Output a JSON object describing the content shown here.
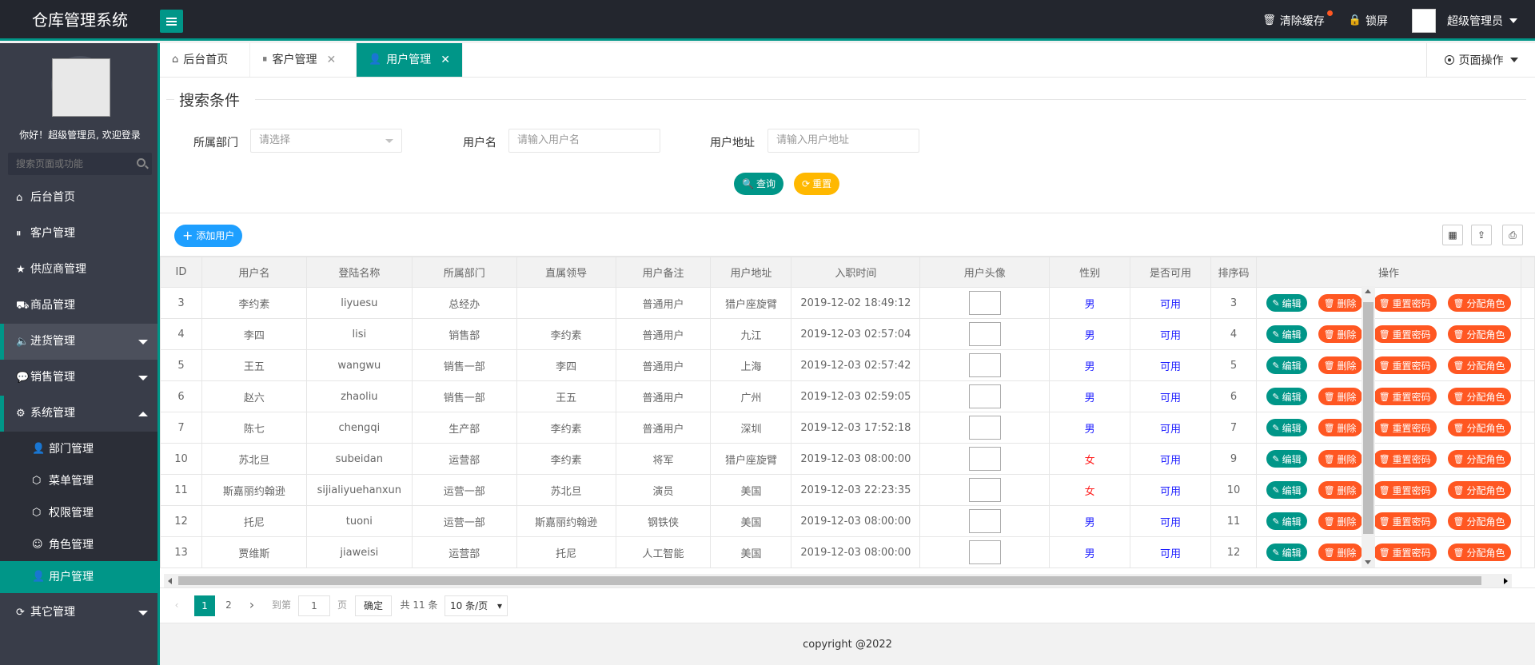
{
  "app": {
    "title": "仓库管理系统"
  },
  "header": {
    "clear_cache": "清除缓存",
    "lock_screen": "锁屏",
    "user": "超级管理员"
  },
  "sidebar": {
    "welcome": "你好！超级管理员, 欢迎登录",
    "search_placeholder": "搜索页面或功能",
    "items": [
      {
        "label": "后台首页",
        "icon": "home-icon"
      },
      {
        "label": "客户管理",
        "icon": "pause-circle-icon"
      },
      {
        "label": "供应商管理",
        "icon": "star-icon"
      },
      {
        "label": "商品管理",
        "icon": "cart-icon"
      },
      {
        "label": "进货管理",
        "icon": "speaker-icon"
      },
      {
        "label": "销售管理",
        "icon": "chat-icon"
      },
      {
        "label": "系统管理",
        "icon": "gear-icon"
      }
    ],
    "sub_items": [
      {
        "label": "部门管理",
        "icon": "user-outline-icon"
      },
      {
        "label": "菜单管理",
        "icon": "cube-icon"
      },
      {
        "label": "权限管理",
        "icon": "cube-icon"
      },
      {
        "label": "角色管理",
        "icon": "smile-icon"
      },
      {
        "label": "用户管理",
        "icon": "user-icon"
      }
    ],
    "other": {
      "label": "其它管理",
      "icon": "refresh-icon"
    }
  },
  "tabs": [
    {
      "label": "后台首页",
      "icon": "home-icon"
    },
    {
      "label": "客户管理",
      "icon": "pause-circle-icon"
    },
    {
      "label": "用户管理",
      "icon": "user-icon"
    }
  ],
  "page_ops": "页面操作",
  "search": {
    "legend": "搜索条件",
    "dept_label": "所属部门",
    "dept_placeholder": "请选择",
    "username_label": "用户名",
    "username_placeholder": "请输入用户名",
    "address_label": "用户地址",
    "address_placeholder": "请输入用户地址",
    "query_btn": "查询",
    "reset_btn": "重置"
  },
  "toolbar": {
    "add_user": "添加用户"
  },
  "table": {
    "headers": [
      "ID",
      "用户名",
      "登陆名称",
      "所属部门",
      "直属领导",
      "用户备注",
      "用户地址",
      "入职时间",
      "用户头像",
      "性别",
      "是否可用",
      "排序码",
      "操作"
    ],
    "rows": [
      {
        "id": "3",
        "name": "李约素",
        "login": "liyuesu",
        "dept": "总经办",
        "leader": "",
        "remark": "普通用户",
        "address": "猎户座旋臂",
        "time": "2019-12-02 18:49:12",
        "sex": "男",
        "avail": "可用",
        "order": "3"
      },
      {
        "id": "4",
        "name": "李四",
        "login": "lisi",
        "dept": "销售部",
        "leader": "李约素",
        "remark": "普通用户",
        "address": "九江",
        "time": "2019-12-03 02:57:04",
        "sex": "男",
        "avail": "可用",
        "order": "4"
      },
      {
        "id": "5",
        "name": "王五",
        "login": "wangwu",
        "dept": "销售一部",
        "leader": "李四",
        "remark": "普通用户",
        "address": "上海",
        "time": "2019-12-03 02:57:42",
        "sex": "男",
        "avail": "可用",
        "order": "5"
      },
      {
        "id": "6",
        "name": "赵六",
        "login": "zhaoliu",
        "dept": "销售一部",
        "leader": "王五",
        "remark": "普通用户",
        "address": "广州",
        "time": "2019-12-03 02:59:05",
        "sex": "男",
        "avail": "可用",
        "order": "6"
      },
      {
        "id": "7",
        "name": "陈七",
        "login": "chengqi",
        "dept": "生产部",
        "leader": "李约素",
        "remark": "普通用户",
        "address": "深圳",
        "time": "2019-12-03 17:52:18",
        "sex": "男",
        "avail": "可用",
        "order": "7"
      },
      {
        "id": "10",
        "name": "苏北旦",
        "login": "subeidan",
        "dept": "运营部",
        "leader": "李约素",
        "remark": "将军",
        "address": "猎户座旋臂",
        "time": "2019-12-03 08:00:00",
        "sex": "女",
        "avail": "可用",
        "order": "9"
      },
      {
        "id": "11",
        "name": "斯嘉丽约翰逊",
        "login": "sijialiyuehanxun",
        "dept": "运营一部",
        "leader": "苏北旦",
        "remark": "演员",
        "address": "美国",
        "time": "2019-12-03 22:23:35",
        "sex": "女",
        "avail": "可用",
        "order": "10"
      },
      {
        "id": "12",
        "name": "托尼",
        "login": "tuoni",
        "dept": "运营一部",
        "leader": "斯嘉丽约翰逊",
        "remark": "钢铁侠",
        "address": "美国",
        "time": "2019-12-03 08:00:00",
        "sex": "男",
        "avail": "可用",
        "order": "11"
      },
      {
        "id": "13",
        "name": "贾维斯",
        "login": "jiaweisi",
        "dept": "运营部",
        "leader": "托尼",
        "remark": "人工智能",
        "address": "美国",
        "time": "2019-12-03 08:00:00",
        "sex": "男",
        "avail": "可用",
        "order": "12"
      }
    ],
    "ops": {
      "edit": "编辑",
      "delete": "删除",
      "reset_pwd": "重置密码",
      "assign_role": "分配角色"
    }
  },
  "pager": {
    "pages": [
      "1",
      "2"
    ],
    "current": "1",
    "goto_label": "到第",
    "goto_value": "1",
    "page_unit": "页",
    "confirm": "确定",
    "total": "共 11 条",
    "page_size": "10 条/页"
  },
  "footer": {
    "copyright": "copyright @2022"
  },
  "colors": {
    "accent": "#009688",
    "header": "#23262e",
    "sidebar": "#393d49",
    "danger": "#ff5722",
    "warn": "#ffb800",
    "info": "#1e9fff"
  }
}
